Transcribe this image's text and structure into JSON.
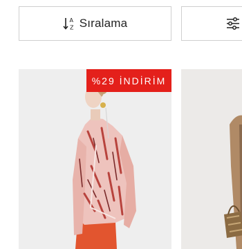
{
  "toolbar": {
    "sort_label": "Sıralama",
    "sort_icon": "sort-ascending-icon",
    "filter_icon": "filter-sliders-icon"
  },
  "products": [
    {
      "badge": "%29 İNDİRİM"
    }
  ],
  "colors": {
    "badge_red": "#e4201b",
    "border_gray": "#cfcfcf",
    "card_background": "#eeeeee"
  }
}
